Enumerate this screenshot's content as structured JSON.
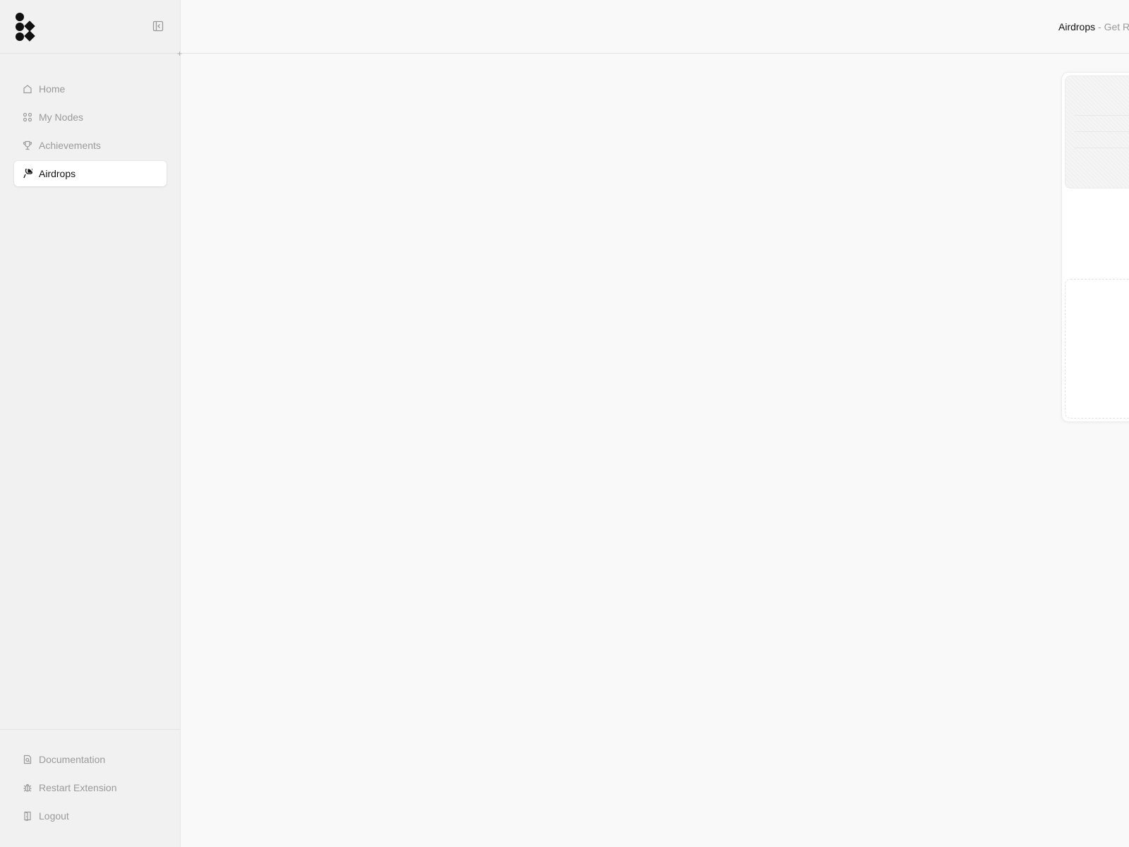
{
  "header": {
    "title": "Airdrops",
    "subtitle": "- Get R"
  },
  "sidebar": {
    "logo_icon": "dots-logo-icon",
    "items": [
      {
        "label": "Home",
        "icon": "home-icon",
        "active": false
      },
      {
        "label": "My Nodes",
        "icon": "nodes-grid-icon",
        "active": false
      },
      {
        "label": "Achievements",
        "icon": "trophy-icon",
        "active": false
      },
      {
        "label": "Airdrops",
        "icon": "parachute-icon",
        "active": true
      }
    ],
    "footer_items": [
      {
        "label": "Documentation",
        "icon": "document-search-icon"
      },
      {
        "label": "Restart Extension",
        "icon": "bug-icon"
      },
      {
        "label": "Logout",
        "icon": "logout-icon"
      }
    ]
  },
  "colors": {
    "background": "#f9f9f9",
    "sidebar_bg": "#f1f1f1",
    "active_item_bg": "#ffffff",
    "muted_text": "#9a9a9a"
  }
}
